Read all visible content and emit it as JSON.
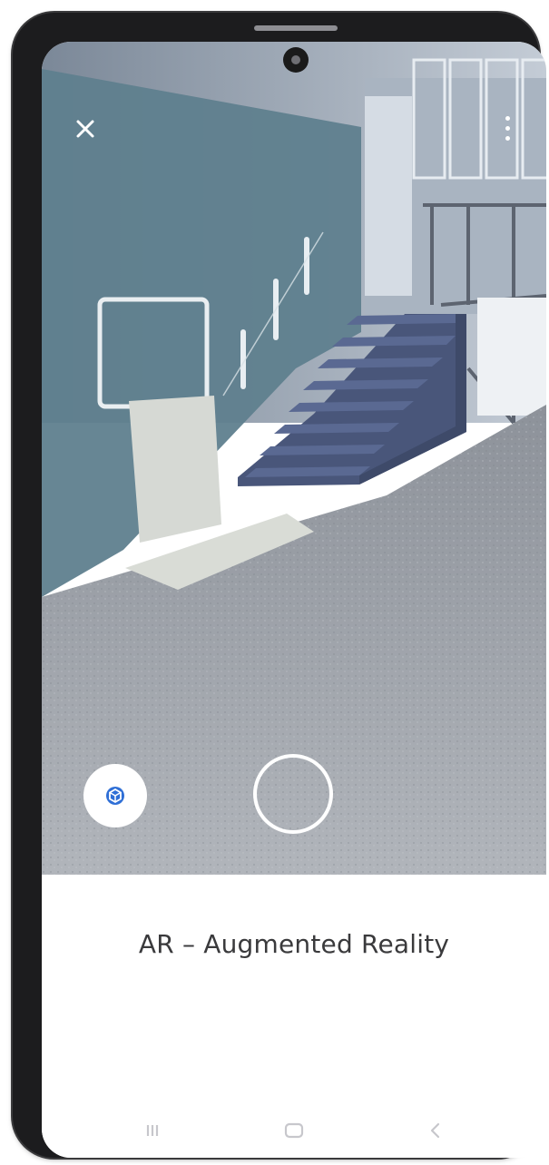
{
  "ar_view": {
    "close_icon": "close-icon",
    "menu_icon": "more-vertical-icon",
    "reset_icon": "cube-reset-icon",
    "shutter_icon": "capture-circle-icon"
  },
  "panel": {
    "title": "AR – Augmented Reality"
  },
  "navigation": {
    "recent_icon": "recent-apps-icon",
    "home_icon": "home-icon",
    "back_icon": "back-icon"
  },
  "colors": {
    "wall": "#5f7f8e",
    "floor": "#9a9fa6",
    "stairs": "#4a5777",
    "panel_bg": "#ffffff",
    "phone_frame": "#1c1c1e"
  }
}
